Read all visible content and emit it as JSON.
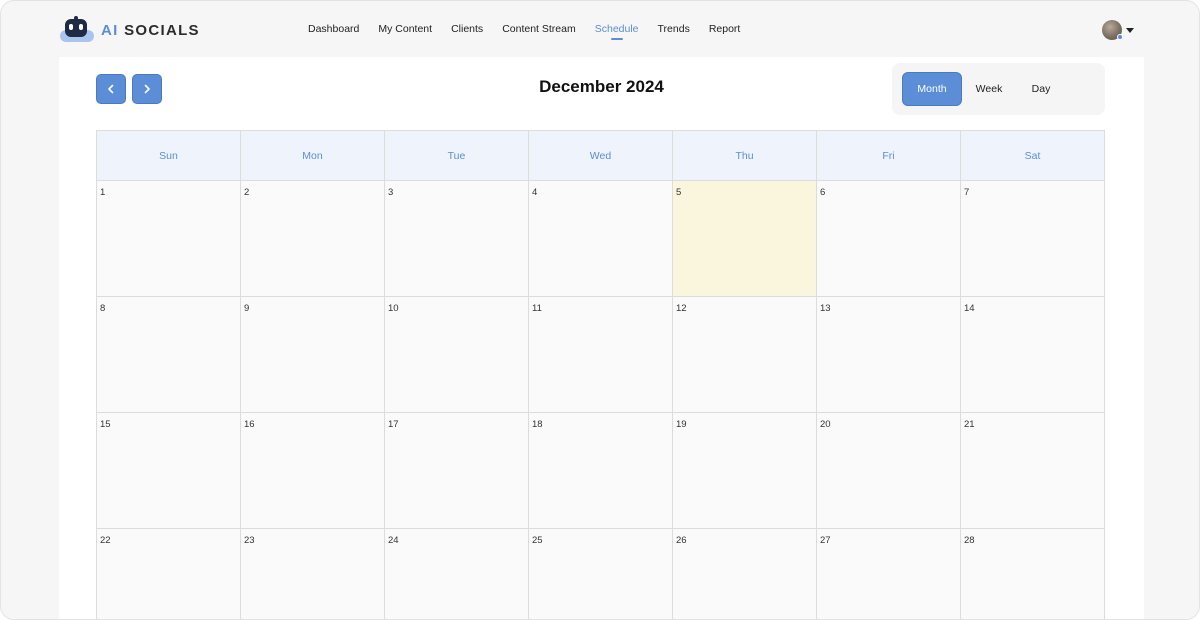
{
  "app": {
    "logo_prefix": "AI",
    "logo_suffix": " SOCIALS",
    "brand_color": "#5b8ed6"
  },
  "nav": {
    "items": [
      {
        "label": "Dashboard",
        "active": false
      },
      {
        "label": "My Content",
        "active": false
      },
      {
        "label": "Clients",
        "active": false
      },
      {
        "label": "Content Stream",
        "active": false
      },
      {
        "label": "Schedule",
        "active": true
      },
      {
        "label": "Trends",
        "active": false
      },
      {
        "label": "Report",
        "active": false
      }
    ]
  },
  "user": {
    "avatar_icon": "user-avatar",
    "menu_icon": "caret-down-icon"
  },
  "calendar": {
    "title": "December 2024",
    "prev_icon": "chevron-left-icon",
    "next_icon": "chevron-right-icon",
    "views": [
      {
        "label": "Month",
        "active": true
      },
      {
        "label": "Week",
        "active": false
      },
      {
        "label": "Day",
        "active": false
      }
    ],
    "weekdays": [
      "Sun",
      "Mon",
      "Tue",
      "Wed",
      "Thu",
      "Fri",
      "Sat"
    ],
    "today": "5",
    "today_color": "#faf6dd",
    "weeks": [
      [
        "1",
        "2",
        "3",
        "4",
        "5",
        "6",
        "7"
      ],
      [
        "8",
        "9",
        "10",
        "11",
        "12",
        "13",
        "14"
      ],
      [
        "15",
        "16",
        "17",
        "18",
        "19",
        "20",
        "21"
      ],
      [
        "22",
        "23",
        "24",
        "25",
        "26",
        "27",
        "28"
      ]
    ]
  }
}
